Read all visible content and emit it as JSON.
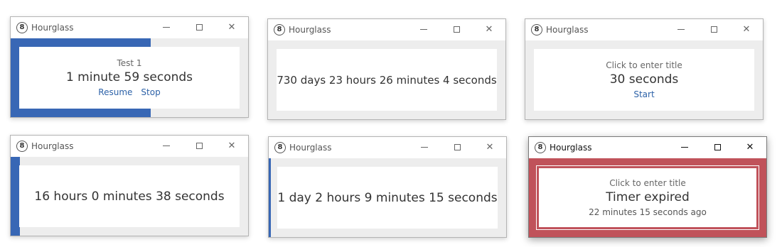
{
  "windows": [
    {
      "app_title": "Hourglass",
      "app_icon": "8",
      "timer_title": "Test 1",
      "time": "1 minute 59 seconds",
      "progress": 0.59,
      "actions": [
        "Resume",
        "Stop"
      ]
    },
    {
      "app_title": "Hourglass",
      "app_icon": "8",
      "time": "730 days 23 hours 26 minutes 4 seconds"
    },
    {
      "app_title": "Hourglass",
      "app_icon": "8",
      "timer_title": "Click to enter title",
      "time": "30 seconds",
      "actions": [
        "Start"
      ]
    },
    {
      "app_title": "Hourglass",
      "app_icon": "8",
      "time": "16 hours 0 minutes 38 seconds",
      "progress": 0.04
    },
    {
      "app_title": "Hourglass",
      "app_icon": "8",
      "time": "1 day 2 hours 9 minutes 15 seconds",
      "progress": 0.01
    },
    {
      "app_title": "Hourglass",
      "app_icon": "8",
      "timer_title": "Click to enter title",
      "time": "Timer expired",
      "expired_ago": "22 minutes 15 seconds ago",
      "state": "expired",
      "active": true
    }
  ],
  "colors": {
    "progress": "#3867b5",
    "expired": "#c0525a",
    "link": "#2d62a8"
  },
  "icons": {
    "app": "hourglass-8-icon",
    "minimize": "minimize-icon",
    "maximize": "maximize-icon",
    "close": "close-icon"
  }
}
